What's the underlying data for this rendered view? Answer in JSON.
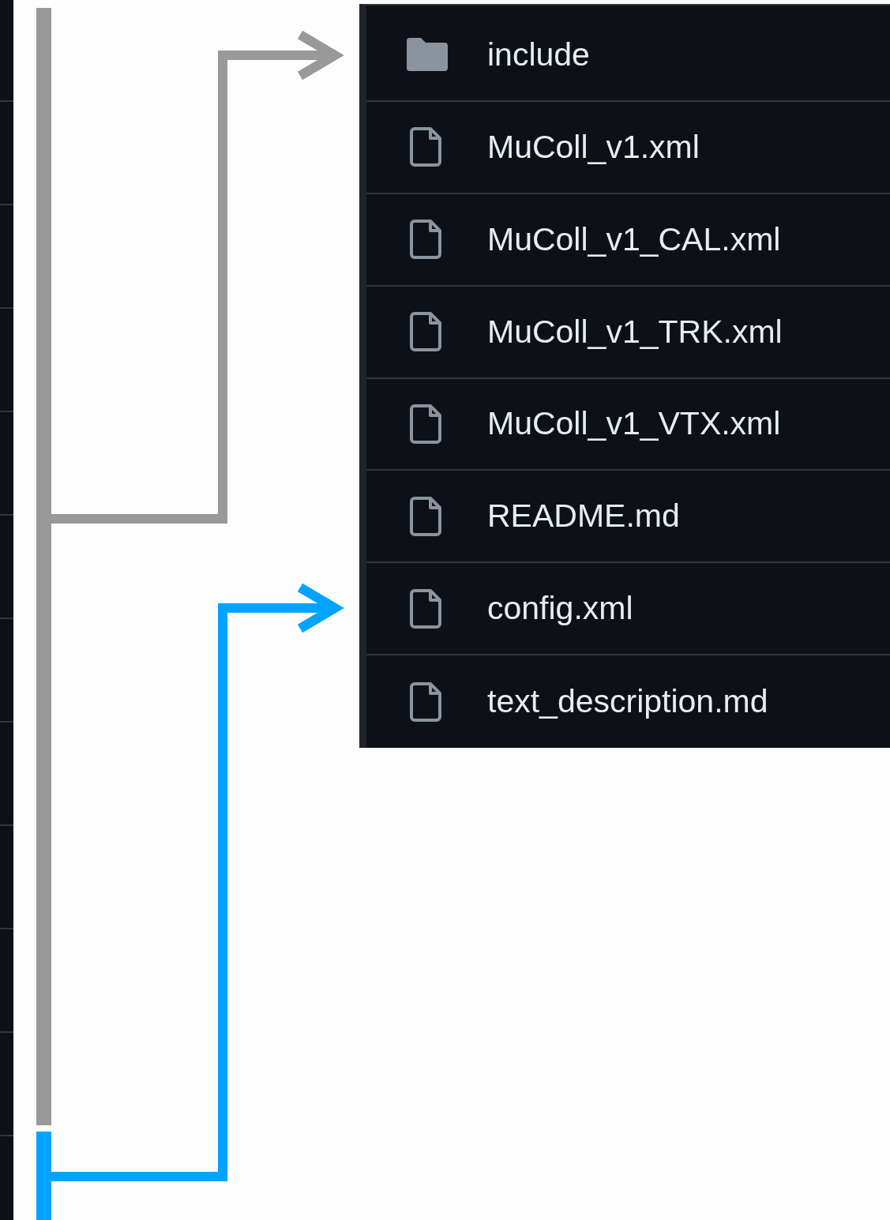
{
  "files": [
    {
      "name": "include",
      "kind": "folder"
    },
    {
      "name": "MuColl_v1.xml",
      "kind": "file"
    },
    {
      "name": "MuColl_v1_CAL.xml",
      "kind": "file"
    },
    {
      "name": "MuColl_v1_TRK.xml",
      "kind": "file"
    },
    {
      "name": "MuColl_v1_VTX.xml",
      "kind": "file"
    },
    {
      "name": "README.md",
      "kind": "file"
    },
    {
      "name": "config.xml",
      "kind": "file"
    },
    {
      "name": "text_description.md",
      "kind": "file"
    }
  ]
}
